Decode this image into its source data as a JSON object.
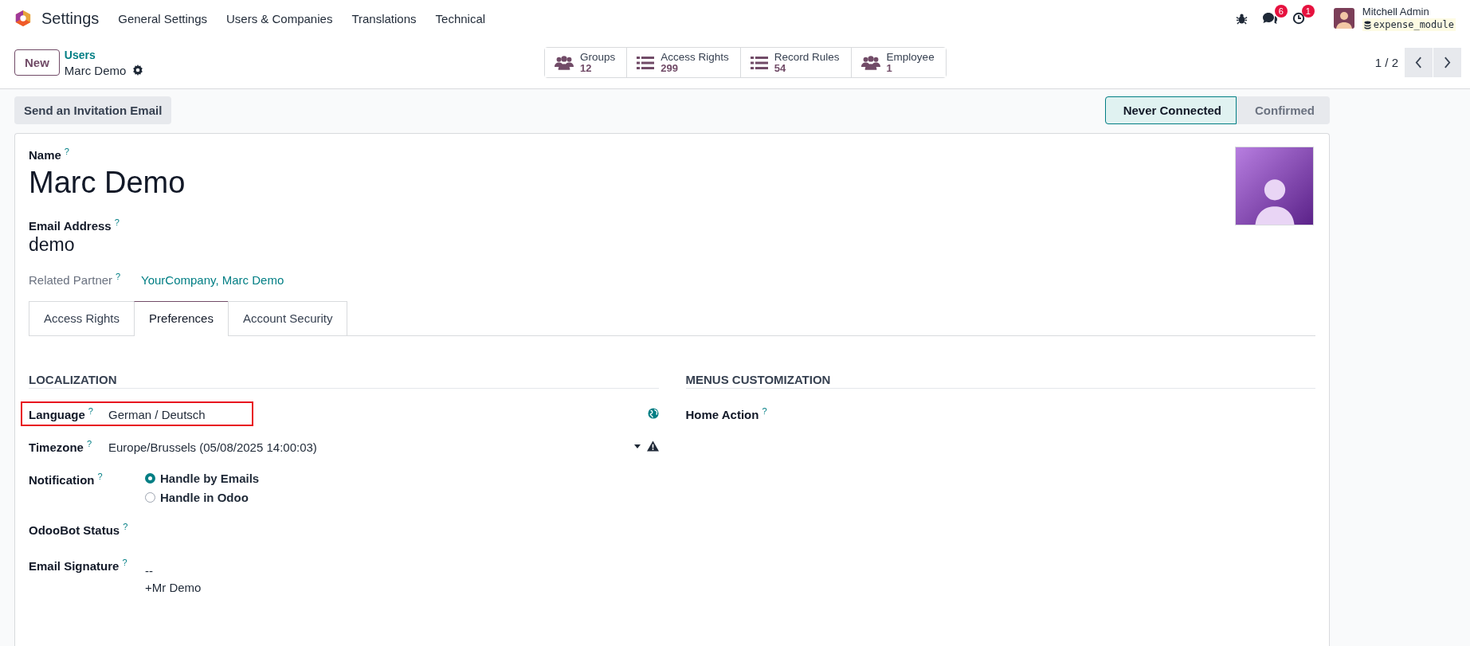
{
  "navbar": {
    "app_name": "Settings",
    "menus": [
      "General Settings",
      "Users & Companies",
      "Translations",
      "Technical"
    ],
    "messages_count": "6",
    "activities_count": "1",
    "user_name": "Mitchell Admin",
    "database": "expense_module"
  },
  "control_panel": {
    "new_button": "New",
    "breadcrumb": "Users",
    "record_name": "Marc Demo",
    "smart_buttons": [
      {
        "kind": "people",
        "label": "Groups",
        "count": "12"
      },
      {
        "kind": "list",
        "label": "Access Rights",
        "count": "299"
      },
      {
        "kind": "list",
        "label": "Record Rules",
        "count": "54"
      },
      {
        "kind": "people",
        "label": "Employee",
        "count": "1"
      }
    ],
    "pager": "1 / 2"
  },
  "statusbar": {
    "button": "Send an Invitation Email",
    "stages": [
      {
        "label": "Never Connected",
        "selected": true
      },
      {
        "label": "Confirmed",
        "selected": false
      }
    ]
  },
  "form": {
    "name_label": "Name",
    "name_help": "?",
    "name": "Marc Demo",
    "email_label": "Email Address",
    "email_help": "?",
    "email": "demo",
    "partner_label": "Related Partner",
    "partner_help": "?",
    "partner": "YourCompany, Marc Demo",
    "tabs": [
      {
        "label": "Access Rights",
        "selected": false
      },
      {
        "label": "Preferences",
        "selected": true
      },
      {
        "label": "Account Security",
        "selected": false
      }
    ],
    "sections": [
      {
        "title": "LOCALIZATION",
        "fields": [
          {
            "kind": "text",
            "label": "Language",
            "help": "?",
            "value": "German / Deutsch",
            "highlighted": true
          },
          {
            "kind": "select",
            "label": "Timezone",
            "help": "?",
            "value": "Europe/Brussels (05/08/2025 14:00:03)",
            "highlighted": false
          },
          {
            "kind": "radio",
            "label": "Notification",
            "help": "?",
            "options": [
              {
                "label": "Handle by Emails",
                "selected": true
              },
              {
                "label": "Handle in Odoo",
                "selected": false
              }
            ],
            "highlighted": false
          },
          {
            "kind": "empty",
            "label": "OdooBot Status",
            "help": "?",
            "highlighted": false
          },
          {
            "kind": "multiline",
            "label": "Email Signature",
            "help": "?",
            "lines": [
              "--",
              "+Mr Demo"
            ],
            "highlighted": false
          }
        ]
      },
      {
        "title": "MENUS CUSTOMIZATION",
        "fields": [
          {
            "kind": "empty",
            "label": "Home Action",
            "help": "?",
            "highlighted": false
          }
        ]
      }
    ]
  }
}
